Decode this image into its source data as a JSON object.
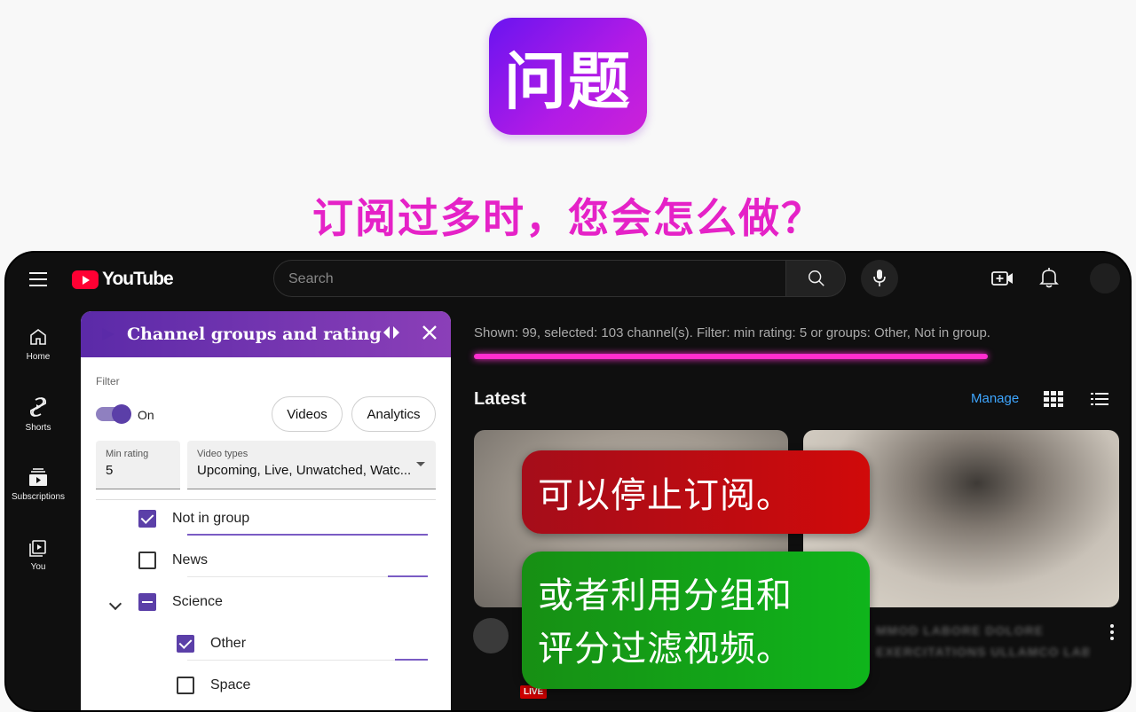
{
  "banner": {
    "badge_text": "问题",
    "question": "订阅过多时，您会怎么做？"
  },
  "youtube": {
    "logo_text": "YouTube",
    "search_placeholder": "Search",
    "sidebar": [
      {
        "label": "Home",
        "icon": "home-icon"
      },
      {
        "label": "Shorts",
        "icon": "shorts-icon"
      },
      {
        "label": "Subscriptions",
        "icon": "subscriptions-icon"
      },
      {
        "label": "You",
        "icon": "you-icon"
      }
    ],
    "status_text": "Shown: 99, selected: 103 channel(s). Filter: min rating: 5 or groups: Other, Not in group.",
    "latest_title": "Latest",
    "manage_label": "Manage",
    "live_badge": "LIVE",
    "blurred_title_lines": [
      "MMOD LABORE DOLORE",
      "EXERCITATIONS ULLAMCO LABORIS ex VOLUPTATE NULLA..."
    ],
    "accent_color": "#ff2ecf"
  },
  "panel": {
    "title": "Channel groups and rating",
    "filter_label": "Filter",
    "toggle_label": "On",
    "videos_button": "Videos",
    "analytics_button": "Analytics",
    "min_rating_label": "Min rating",
    "min_rating_value": "5",
    "video_types_label": "Video types",
    "video_types_value": "Upcoming, Live, Unwatched, Watc...",
    "groups": [
      {
        "name": "Not in group",
        "state": "checked",
        "rating": 1.0
      },
      {
        "name": "News",
        "state": "unchecked",
        "rating": 0.15
      },
      {
        "name": "Science",
        "state": "indeterminate",
        "expanded": true
      },
      {
        "name": "Other",
        "state": "checked",
        "rating": 0.15
      },
      {
        "name": "Space",
        "state": "unchecked"
      }
    ],
    "accent_color": "#5b3fa8"
  },
  "callouts": {
    "stop": "可以停止订阅。",
    "filter_line1": "或者利用分组和",
    "filter_line2": "评分过滤视频。"
  }
}
